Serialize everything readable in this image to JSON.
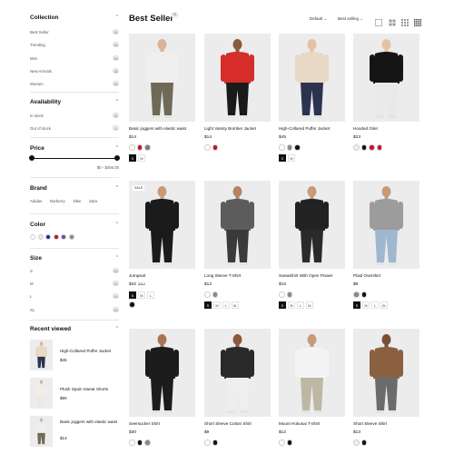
{
  "sidebar": {
    "collection": {
      "title": "Collection",
      "items": [
        {
          "label": "Best Seller",
          "count": "31"
        },
        {
          "label": "Trending",
          "count": "29"
        },
        {
          "label": "Men",
          "count": "29"
        },
        {
          "label": "New Arrivals",
          "count": "28"
        },
        {
          "label": "Women",
          "count": "29"
        }
      ]
    },
    "availability": {
      "title": "Availability",
      "items": [
        {
          "label": "In stock",
          "count": "31"
        },
        {
          "label": "Out of stock",
          "count": "0"
        }
      ]
    },
    "price": {
      "title": "Price",
      "range": "$0 - $456.00",
      "min_fraction": 0,
      "max_fraction": 1
    },
    "brand": {
      "title": "Brand",
      "items": [
        "Adidas",
        "Burberry",
        "Nike",
        "Zara"
      ]
    },
    "color": {
      "title": "Color",
      "swatches": [
        "#ffffff",
        "#e8e8e8",
        "#1b2a8c",
        "#b01626",
        "#8a3a9e",
        "#888888"
      ]
    },
    "size": {
      "title": "Size",
      "items": [
        {
          "label": "S",
          "count": "20"
        },
        {
          "label": "M",
          "count": "21"
        },
        {
          "label": "L",
          "count": "19"
        },
        {
          "label": "XL",
          "count": "15"
        }
      ]
    },
    "recent": {
      "title": "Recent viewed",
      "items": [
        {
          "name": "High-Collared Puffer Jacket",
          "price": "$45",
          "top_color": "#e8d8c6",
          "bottom_color": "#2b3350"
        },
        {
          "name": "Plush Spain Sweat Shorts",
          "price": "$90",
          "top_color": "#f2ede6",
          "bottom_color": "#efe9e1"
        },
        {
          "name": "Basic joggers with elastic waist",
          "price": "$14",
          "top_color": "#efefef",
          "bottom_color": "#6f6a58"
        }
      ]
    }
  },
  "header": {
    "title": "Best Seller",
    "count": "31",
    "sort_default": "Default",
    "sort_by": "Best selling"
  },
  "products": [
    {
      "name": "Basic joggers with elastic waist",
      "price": "$14",
      "old_price": "",
      "sale": "",
      "swatches": [
        "#ffffff",
        "#c8102e",
        "#7a7a7a"
      ],
      "sizes": [
        "S",
        "M"
      ],
      "top": "#efefef",
      "bottom": "#6f6a58",
      "skin": "#d7b49a"
    },
    {
      "name": "Light Varsity Bomber Jacket",
      "price": "$14",
      "old_price": "",
      "sale": "",
      "swatches": [
        "#ffffff",
        "#c8102e"
      ],
      "sizes": [],
      "top": "#d62c2c",
      "bottom": "#1a1a1a",
      "skin": "#8a5a3c"
    },
    {
      "name": "High-Collared Puffer Jacket",
      "price": "$45",
      "old_price": "",
      "sale": "",
      "swatches": [
        "#ffffff",
        "#888888",
        "#111111"
      ],
      "sizes": [
        "S",
        "M"
      ],
      "top": "#e8d8c6",
      "bottom": "#2b3350",
      "skin": "#e3c2a6"
    },
    {
      "name": "Hooded Gilet",
      "price": "$23",
      "old_price": "",
      "sale": "",
      "swatches": [
        "#f3f0de",
        "#111111",
        "#c8102e",
        "#c8102e"
      ],
      "sizes": [],
      "top": "#151515",
      "bottom": "#e9e9e9",
      "skin": "#e3c2a6"
    },
    {
      "name": "Jumpsuit",
      "price": "$32",
      "old_price": "$54",
      "sale": "SALE",
      "swatches": [],
      "sizes": [
        "S",
        "M",
        "L"
      ],
      "top": "#1b1b1b",
      "bottom": "#1b1b1b",
      "skin": "#c79a7a"
    },
    {
      "name": "Long Sleeve T-Shirt",
      "price": "$12",
      "old_price": "",
      "sale": "",
      "swatches": [
        "#ffffff",
        "#888888"
      ],
      "sizes": [
        "S",
        "M",
        "L",
        "XL"
      ],
      "top": "#5c5c5c",
      "bottom": "#3a3a3a",
      "skin": "#b58362"
    },
    {
      "name": "Sweatshirt With Open Flower",
      "price": "$15",
      "old_price": "",
      "sale": "",
      "swatches": [
        "#ffffff",
        "#888888"
      ],
      "sizes": [
        "S",
        "M",
        "L",
        "XL"
      ],
      "top": "#222222",
      "bottom": "#2a2a2a",
      "skin": "#c79a7a"
    },
    {
      "name": "Plaid Overshirt",
      "price": "$9",
      "old_price": "",
      "sale": "",
      "swatches": [
        "#888888",
        "#111111"
      ],
      "sizes": [
        "S",
        "M",
        "L",
        "XL"
      ],
      "top": "#9c9c9c",
      "bottom": "#9fb7cf",
      "skin": "#c79a7a"
    },
    {
      "name": "Seersucker Shirt",
      "price": "$30",
      "old_price": "",
      "sale": "",
      "swatches": [
        "#ffffff",
        "#111111",
        "#888888"
      ],
      "sizes": [],
      "top": "#1c1c1c",
      "bottom": "#1c1c1c",
      "skin": "#a87456"
    },
    {
      "name": "Short Sleeve Cotton Shirt",
      "price": "$9",
      "old_price": "",
      "sale": "",
      "swatches": [
        "#ffffff",
        "#111111"
      ],
      "sizes": [],
      "top": "#2a2a2a",
      "bottom": "#eeeeee",
      "skin": "#8a5a3c"
    },
    {
      "name": "Mount Hokusai T-Shirt",
      "price": "$12",
      "old_price": "",
      "sale": "",
      "swatches": [
        "#ffffff",
        "#111111"
      ],
      "sizes": [],
      "top": "#f4f4f4",
      "bottom": "#bdb7a4",
      "skin": "#c79a7a"
    },
    {
      "name": "Short Sleeve Shirt",
      "price": "$13",
      "old_price": "",
      "sale": "",
      "swatches": [
        "#f3f0de",
        "#111111"
      ],
      "sizes": [],
      "top": "#8a6040",
      "bottom": "#6b6b6b",
      "skin": "#7a4f34"
    }
  ]
}
